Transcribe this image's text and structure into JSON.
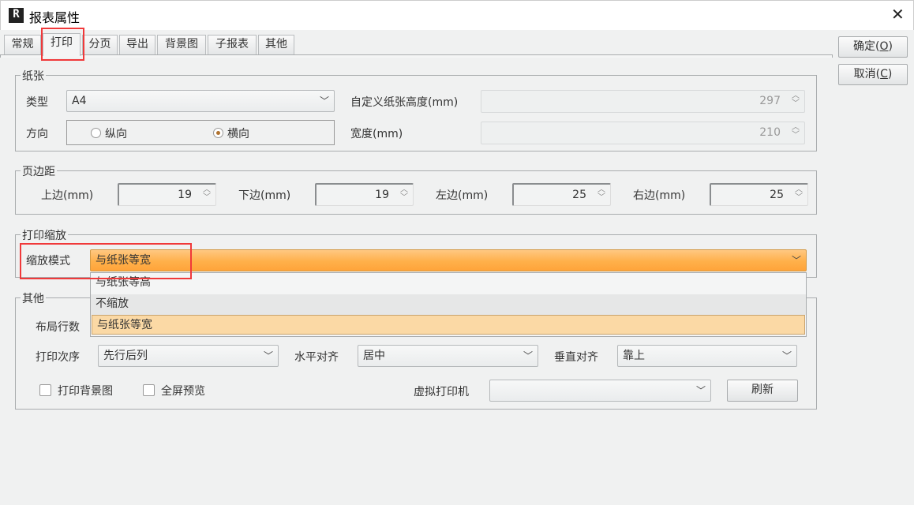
{
  "window": {
    "title": "报表属性",
    "icon": "R",
    "close": "✕"
  },
  "tabs": [
    "常规",
    "打印",
    "分页",
    "导出",
    "背景图",
    "子报表",
    "其他"
  ],
  "buttons": {
    "ok": "确定(",
    "ok_key": "O",
    "cancel": "取消(",
    "cancel_key": "C",
    "close_paren": ")"
  },
  "paper": {
    "legend": "纸张",
    "type_label": "类型",
    "type_value": "A4",
    "orientation_label": "方向",
    "portrait": "纵向",
    "landscape": "横向",
    "custom_height_label": "自定义纸张高度(mm)",
    "custom_height": "297",
    "width_label": "宽度(mm)",
    "width": "210"
  },
  "margins": {
    "legend": "页边距",
    "top_label": "上边(mm)",
    "top": "19",
    "bottom_label": "下边(mm)",
    "bottom": "19",
    "left_label": "左边(mm)",
    "left": "25",
    "right_label": "右边(mm)",
    "right": "25"
  },
  "scale": {
    "legend": "打印缩放",
    "mode_label": "缩放模式",
    "mode_value": "与纸张等宽",
    "options": [
      "与纸张等高",
      "不缩放",
      "与纸张等宽"
    ]
  },
  "other": {
    "legend": "其他",
    "layout_rows_label": "布局行数",
    "order_label": "打印次序",
    "order_value": "先行后列",
    "halign_label": "水平对齐",
    "halign_value": "居中",
    "valign_label": "垂直对齐",
    "valign_value": "靠上",
    "print_bg": "打印背景图",
    "fullscreen": "全屏预览",
    "printer_label": "虚拟打印机",
    "printer_value": "",
    "refresh": "刷新"
  },
  "colors": {
    "highlight": "#ffb04a",
    "selected_option": "#fbd9a5",
    "annotation": "#f0393a"
  }
}
